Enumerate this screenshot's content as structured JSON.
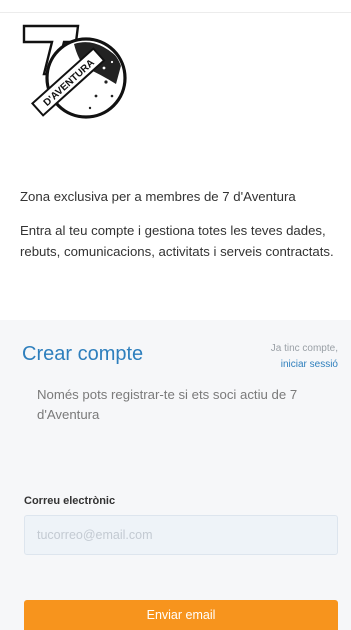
{
  "brand": {
    "logo_text": "D'AVENTURA",
    "logo_numeral": "7"
  },
  "intro": {
    "tagline": "Zona exclusiva per a membres de 7 d'Aventura",
    "description": "Entra al teu compte i gestiona totes les teves dades, rebuts, comunicacions, activitats i serveis contractats."
  },
  "signup": {
    "title": "Crear compte",
    "has_account_text": "Ja tinc compte,",
    "login_link": "iniciar sessió",
    "notice": "Només pots registrar-te si ets soci actiu de 7 d'Aventura",
    "email_label": "Correu electrònic",
    "email_placeholder": "tucorreo@email.com",
    "email_value": "",
    "submit_label": "Enviar email"
  },
  "colors": {
    "accent_blue": "#2e7fbd",
    "button_orange": "#f7941d",
    "card_background": "#f6f7f9",
    "input_background": "#eef3f8"
  }
}
